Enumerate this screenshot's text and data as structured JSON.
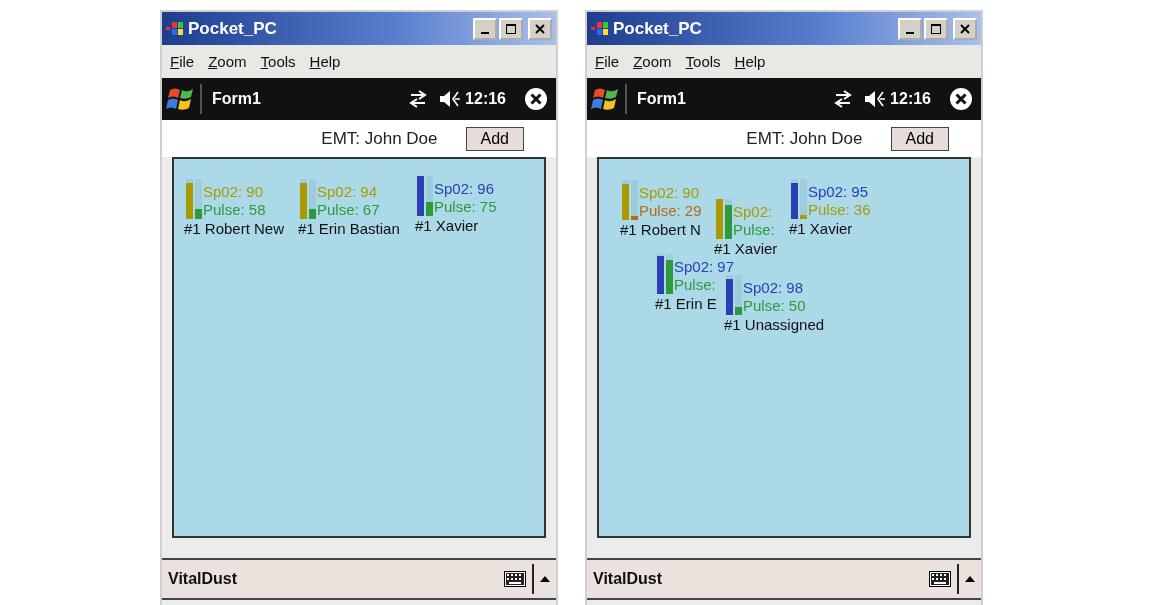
{
  "screens": [
    {
      "window": {
        "title": "Pocket_PC"
      },
      "menu": [
        "File",
        "Zoom",
        "Tools",
        "Help"
      ],
      "taskbar": {
        "title": "Form1",
        "time": "12:16"
      },
      "emt_label": "EMT: John Doe",
      "add_button": "Add",
      "monitors": [
        {
          "name": "#1 Robert New",
          "spo2": {
            "text": "Sp02: 90",
            "color": "#a89a00",
            "level": 0.9
          },
          "pulse": {
            "text": "Pulse: 58",
            "color": "#2f9a3a",
            "level": 0.25
          }
        },
        {
          "name": "#1 Erin Bastian",
          "spo2": {
            "text": "Sp02: 94",
            "color": "#a89a00",
            "level": 0.9
          },
          "pulse": {
            "text": "Pulse: 67",
            "color": "#2f9a3a",
            "level": 0.25
          }
        },
        {
          "name": "#1 Xavier",
          "spo2": {
            "text": "Sp02: 96",
            "color": "#2a3fb4",
            "level": 1.0
          },
          "pulse": {
            "text": "Pulse: 75",
            "color": "#2f9a3a",
            "level": 0.35
          }
        }
      ],
      "softkey_bar": {
        "title": "VitalDust"
      }
    },
    {
      "window": {
        "title": "Pocket_PC"
      },
      "menu": [
        "File",
        "Zoom",
        "Tools",
        "Help"
      ],
      "taskbar": {
        "title": "Form1",
        "time": "12:16"
      },
      "emt_label": "EMT: John Doe",
      "add_button": "Add",
      "monitors": [
        {
          "name": "#1 Robert N",
          "spo2": {
            "text": "Sp02: 90",
            "color": "#a89a00",
            "level": 0.9
          },
          "pulse": {
            "text": "Pulse: 29",
            "color": "#b86a10",
            "level": 0.1
          }
        },
        {
          "name": "#1 Xavier",
          "spo2": {
            "text": "Sp02:",
            "color": "#a89a00",
            "level": 1.0
          },
          "pulse": {
            "text": "Pulse:",
            "color": "#2f9a3a",
            "level": 0.85
          }
        },
        {
          "name": "#1 Xavier",
          "spo2": {
            "text": "Sp02: 95",
            "color": "#2a3fb4",
            "level": 0.9
          },
          "pulse": {
            "text": "Pulse: 36",
            "color": "#a89a00",
            "level": 0.1
          }
        },
        {
          "name": "#1 Erin E",
          "spo2": {
            "text": "Sp02: 97",
            "color": "#2a3fb4",
            "level": 0.95
          },
          "pulse": {
            "text": "Pulse:",
            "color": "#2f9a3a",
            "level": 0.85
          }
        },
        {
          "name": "#1 Unassigned",
          "spo2": {
            "text": "Sp02: 98",
            "color": "#2a3fb4",
            "level": 0.9
          },
          "pulse": {
            "text": "Pulse: 50",
            "color": "#2f9a3a",
            "level": 0.2
          }
        }
      ],
      "softkey_bar": {
        "title": "VitalDust"
      }
    }
  ]
}
